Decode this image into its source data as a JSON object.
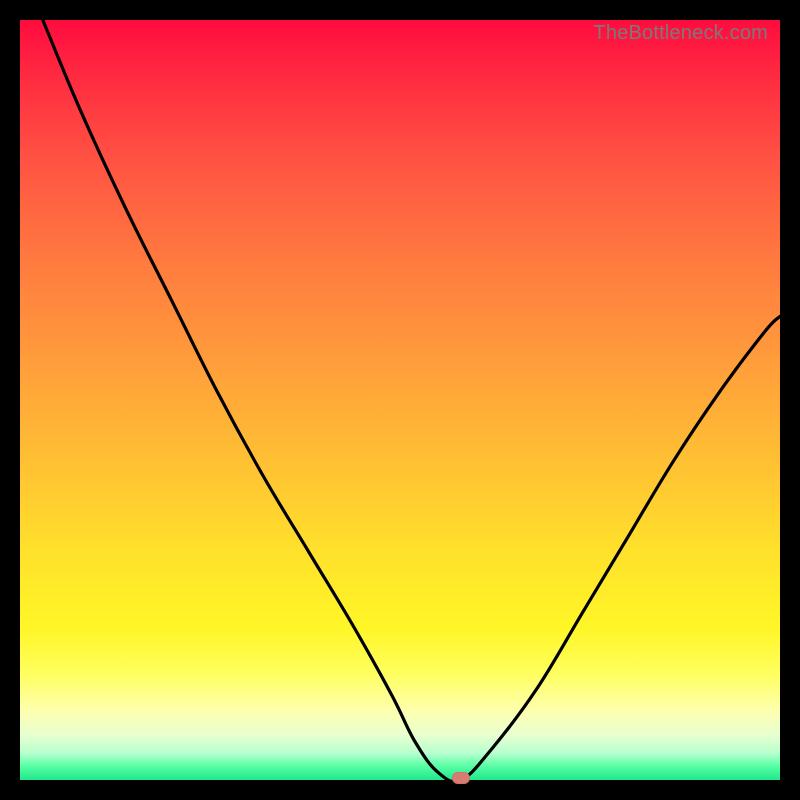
{
  "watermark": "TheBottleneck.com",
  "colors": {
    "frame_bg": "#000000",
    "curve_stroke": "#000000",
    "marker_fill": "#d77b73"
  },
  "chart_data": {
    "type": "line",
    "title": "",
    "xlabel": "",
    "ylabel": "",
    "xlim": [
      0,
      100
    ],
    "ylim": [
      0,
      100
    ],
    "grid": false,
    "legend": false,
    "series": [
      {
        "name": "bottleneck-curve",
        "x": [
          3,
          8,
          14,
          20,
          26,
          32,
          38,
          44,
          49,
          52,
          55,
          58,
          62,
          68,
          74,
          80,
          86,
          92,
          98,
          100
        ],
        "values": [
          100,
          88,
          75,
          63,
          51,
          40,
          30,
          20,
          11,
          5,
          1,
          0,
          4,
          12,
          22,
          32,
          42,
          51,
          59,
          61
        ]
      }
    ],
    "marker": {
      "x": 58,
      "y": 0
    }
  }
}
